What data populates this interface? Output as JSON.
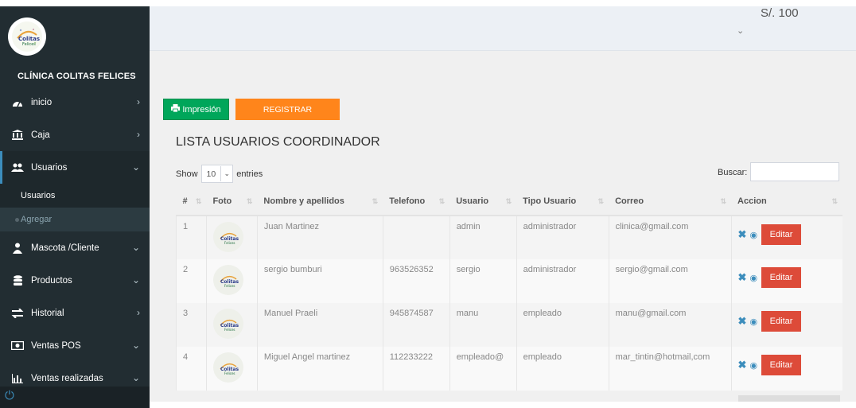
{
  "sidebar": {
    "clinic_name": "CLÍNICA COLITAS FELICES",
    "logo_text": "Colitas Felices",
    "items": [
      {
        "label": "inicio",
        "icon": "dashboard-icon",
        "arrow": "›"
      },
      {
        "label": "Caja",
        "icon": "bank-icon",
        "arrow": "›"
      },
      {
        "label": "Usuarios",
        "icon": "users-icon",
        "arrow": "⌄"
      },
      {
        "label": "Mascota /Cliente",
        "icon": "pet-client-icon",
        "arrow": "⌄"
      },
      {
        "label": "Productos",
        "icon": "database-icon",
        "arrow": "⌄"
      },
      {
        "label": "Historial",
        "icon": "history-icon",
        "arrow": "›"
      },
      {
        "label": "Ventas POS",
        "icon": "money-icon",
        "arrow": "⌄"
      },
      {
        "label": "Ventas realizadas",
        "icon": "bar-chart-icon",
        "arrow": "⌄"
      }
    ],
    "submenu": [
      "Usuarios",
      "Agregar"
    ]
  },
  "header": {
    "balance": "S/. 100",
    "chevron": "⌄"
  },
  "toolbar": {
    "print_label": "Impresión",
    "register_label": "REGISTRAR"
  },
  "list": {
    "title": "LISTA USUARIOS COORDINADOR",
    "show_label": "Show",
    "entries_value": "10",
    "entries_label": "entries",
    "search_label": "Buscar:"
  },
  "table": {
    "columns": [
      "#",
      "Foto",
      "Nombre y apellidos",
      "Telefono",
      "Usuario",
      "Tipo Usuario",
      "Correo",
      "Accion"
    ],
    "rows": [
      {
        "num": "1",
        "name": "Juan Martinez",
        "phone": "",
        "user": "admin",
        "type": "administrador",
        "email": "clinica@gmail.com"
      },
      {
        "num": "2",
        "name": "sergio bumburi",
        "phone": "963526352",
        "user": "sergio",
        "type": "administrador",
        "email": "sergio@gmail.com"
      },
      {
        "num": "3",
        "name": "Manuel Praeli",
        "phone": "945874587",
        "user": "manu",
        "type": "empleado",
        "email": "manu@gmail.com"
      },
      {
        "num": "4",
        "name": "Miguel Angel martinez",
        "phone": "112233222",
        "user": "empleado@",
        "type": "empleado",
        "email": "mar_tintin@hotmail,com"
      }
    ],
    "edit_label": "Editar"
  },
  "colors": {
    "sidebar_bg": "#222d32",
    "print_green": "#00a65a",
    "register_orange": "#ff851b",
    "edit_red": "#dd4b39",
    "accent_blue": "#3c8dbc"
  }
}
